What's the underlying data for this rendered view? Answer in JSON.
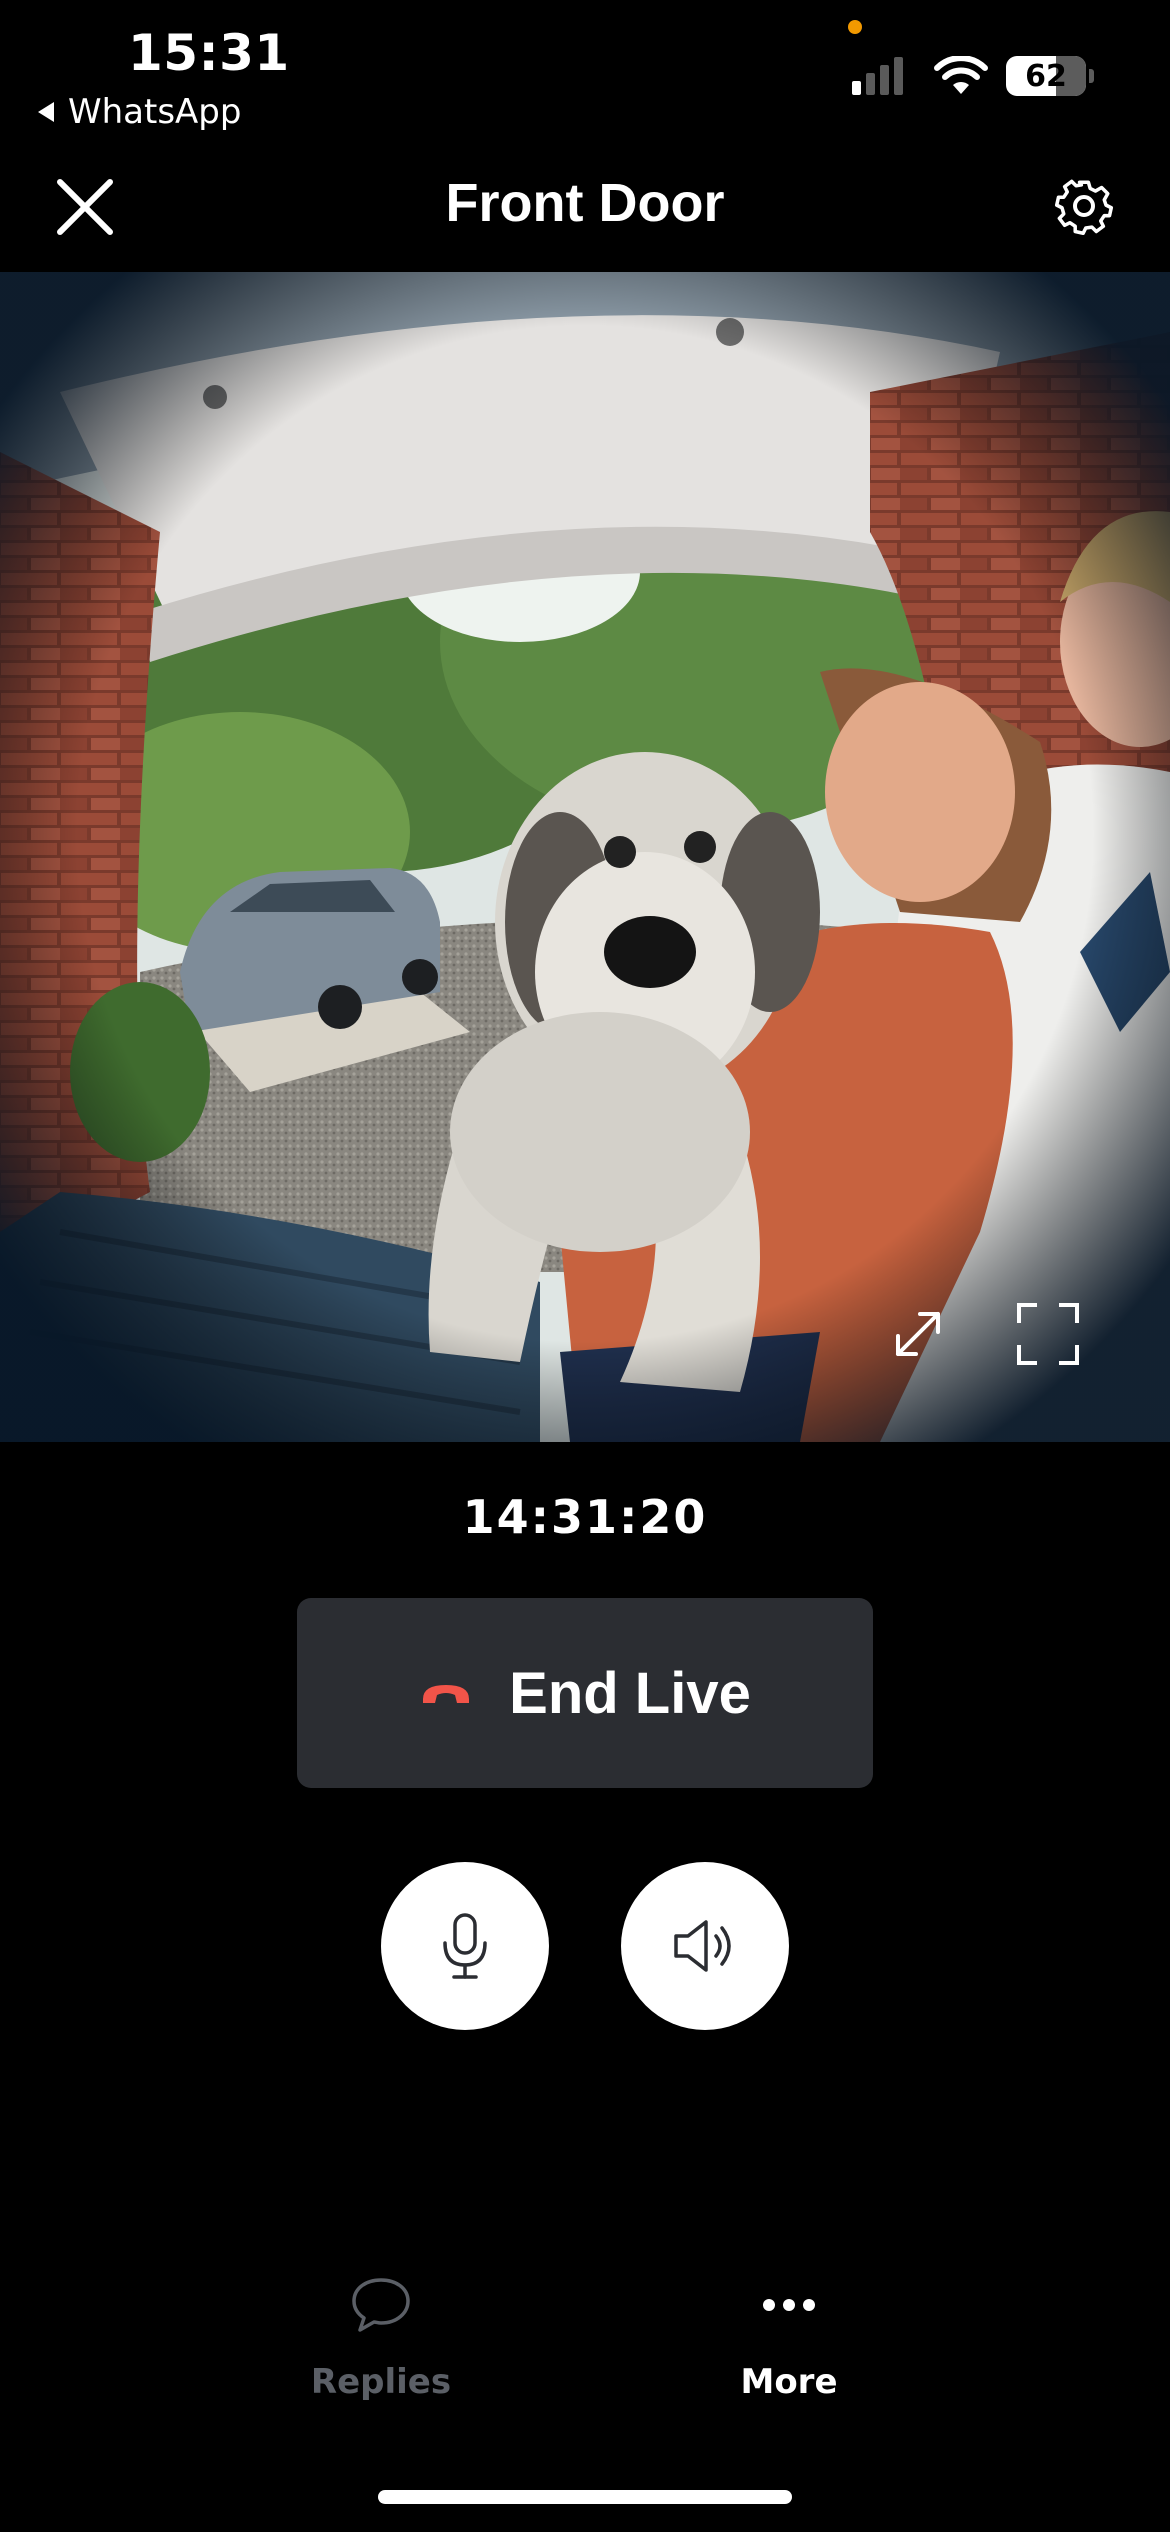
{
  "status_bar": {
    "time": "15:31",
    "back_app": "WhatsApp",
    "battery_percent": "62",
    "signal_bars_active": 1,
    "signal_bars_total": 4,
    "colors": {
      "recording_dot": "#f29900"
    }
  },
  "header": {
    "title": "Front Door",
    "close_icon": "close-icon",
    "settings_icon": "gear-icon"
  },
  "feed": {
    "timestamp": "14:31:20",
    "controls": {
      "expand_icon": "expand-arrows-icon",
      "fullscreen_icon": "fullscreen-icon"
    }
  },
  "actions": {
    "end_live_label": "End Live",
    "end_live_icon": "hang-up-phone-icon",
    "mic_icon": "microphone-icon",
    "speaker_icon": "speaker-icon",
    "colors": {
      "hang_up": "#f25449",
      "button_bg": "#2b2d32"
    }
  },
  "tabs": [
    {
      "label": "Replies",
      "icon": "chat-bubble-icon",
      "active": false
    },
    {
      "label": "More",
      "icon": "more-dots-icon",
      "active": true
    }
  ]
}
